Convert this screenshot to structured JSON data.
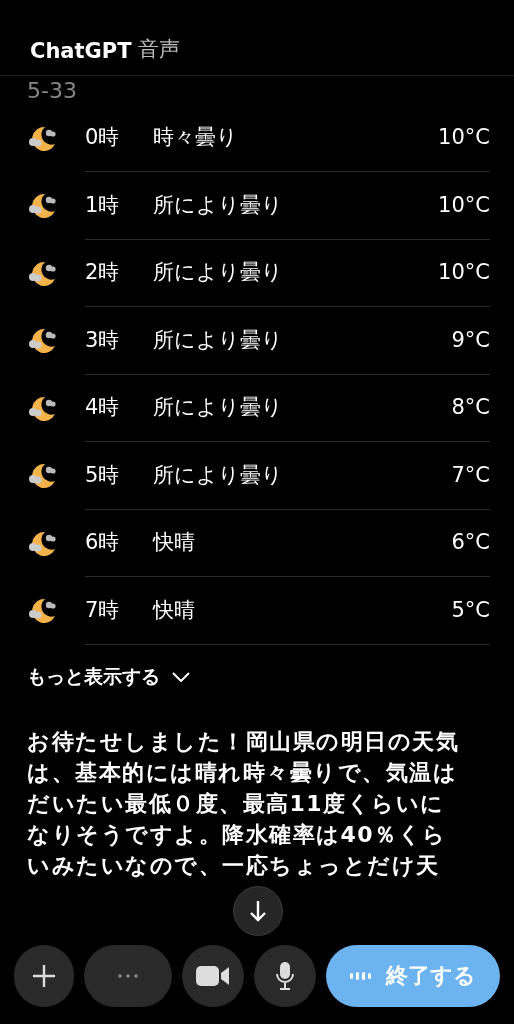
{
  "header": {
    "title": "ChatGPT",
    "subtitle": "音声"
  },
  "location": "5-33",
  "hours": [
    {
      "hour": "0時",
      "condition": "時々曇り",
      "temp": "10°C"
    },
    {
      "hour": "1時",
      "condition": "所により曇り",
      "temp": "10°C"
    },
    {
      "hour": "2時",
      "condition": "所により曇り",
      "temp": "10°C"
    },
    {
      "hour": "3時",
      "condition": "所により曇り",
      "temp": "9°C"
    },
    {
      "hour": "4時",
      "condition": "所により曇り",
      "temp": "8°C"
    },
    {
      "hour": "5時",
      "condition": "所により曇り",
      "temp": "7°C"
    },
    {
      "hour": "6時",
      "condition": "快晴",
      "temp": "6°C"
    },
    {
      "hour": "7時",
      "condition": "快晴",
      "temp": "5°C"
    }
  ],
  "show_more": "もっと表示する",
  "message": "お待たせしました！岡山県の明日の天気は、基本的には晴れ時々曇りで、気温はだいたい最低０度、最高11度くらいになりそうですよ。降水確率は40％くらいみたいなので、一応ちょっとだけ天",
  "end_button": "終了する"
}
